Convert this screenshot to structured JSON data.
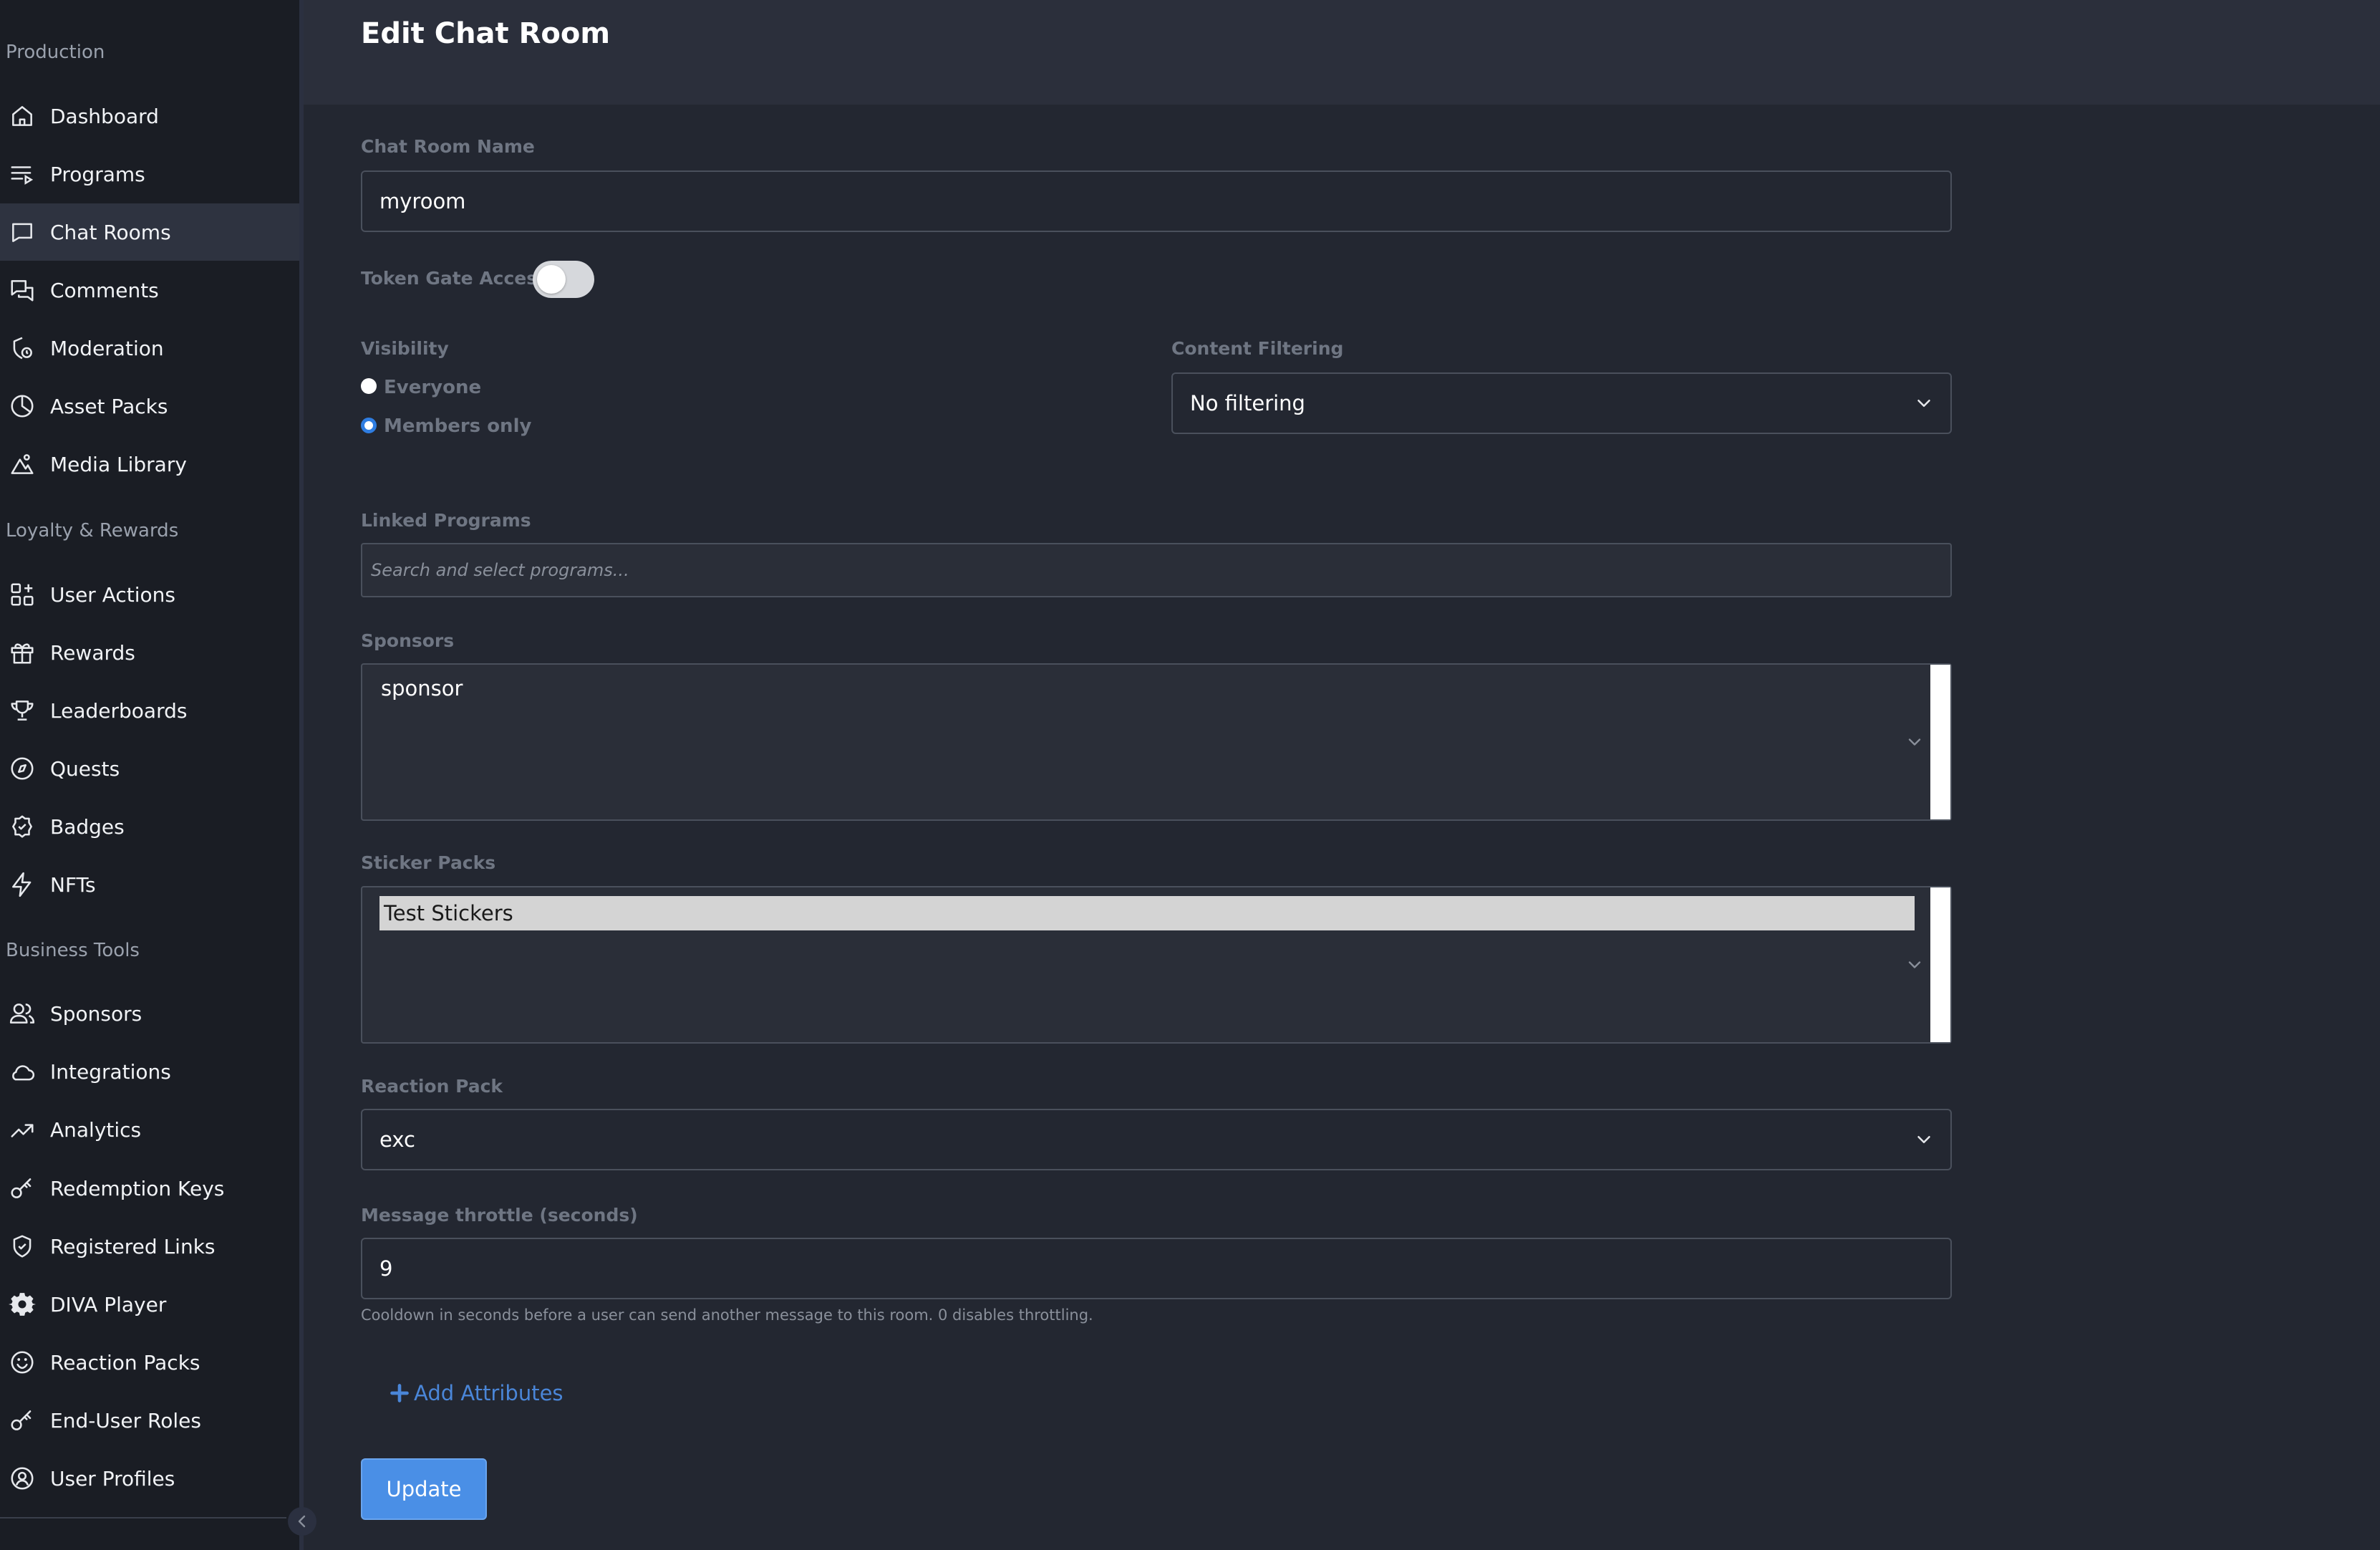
{
  "sidebar": {
    "sections": [
      {
        "title": "Production"
      },
      {
        "title": "Loyalty & Rewards"
      },
      {
        "title": "Business Tools"
      }
    ],
    "items": [
      {
        "label": "Dashboard",
        "icon": "home-icon"
      },
      {
        "label": "Programs",
        "icon": "playlist-icon"
      },
      {
        "label": "Chat Rooms",
        "icon": "chat-bubble-icon",
        "active": true
      },
      {
        "label": "Comments",
        "icon": "comments-icon"
      },
      {
        "label": "Moderation",
        "icon": "moderation-icon"
      },
      {
        "label": "Asset Packs",
        "icon": "pie-chart-icon"
      },
      {
        "label": "Media Library",
        "icon": "image-icon"
      },
      {
        "label": "User Actions",
        "icon": "grid-plus-icon"
      },
      {
        "label": "Rewards",
        "icon": "gift-icon"
      },
      {
        "label": "Leaderboards",
        "icon": "trophy-icon"
      },
      {
        "label": "Quests",
        "icon": "compass-icon"
      },
      {
        "label": "Badges",
        "icon": "badge-icon"
      },
      {
        "label": "NFTs",
        "icon": "lightning-icon"
      },
      {
        "label": "Sponsors",
        "icon": "users-icon"
      },
      {
        "label": "Integrations",
        "icon": "cloud-icon"
      },
      {
        "label": "Analytics",
        "icon": "trending-icon"
      },
      {
        "label": "Redemption Keys",
        "icon": "key-icon"
      },
      {
        "label": "Registered Links",
        "icon": "shield-check-icon"
      },
      {
        "label": "DIVA Player",
        "icon": "gear-icon"
      },
      {
        "label": "Reaction Packs",
        "icon": "smile-icon"
      },
      {
        "label": "End-User Roles",
        "icon": "key-icon"
      },
      {
        "label": "User Profiles",
        "icon": "user-circle-icon"
      }
    ]
  },
  "header": {
    "title": "Edit Chat Room"
  },
  "form": {
    "chat_room_name": {
      "label": "Chat Room Name",
      "value": "myroom"
    },
    "token_gate": {
      "label": "Token Gate Access",
      "enabled": false
    },
    "visibility": {
      "label": "Visibility",
      "options": [
        "Everyone",
        "Members only"
      ],
      "selected": "Members only"
    },
    "content_filtering": {
      "label": "Content Filtering",
      "value": "No filtering"
    },
    "linked_programs": {
      "label": "Linked Programs",
      "placeholder": "Search and select programs..."
    },
    "sponsors": {
      "label": "Sponsors",
      "options": [
        "sponsor"
      ]
    },
    "sticker_packs": {
      "label": "Sticker Packs",
      "options": [
        "Test Stickers"
      ],
      "selected": "Test Stickers"
    },
    "reaction_pack": {
      "label": "Reaction Pack",
      "value": "exc"
    },
    "message_throttle": {
      "label": "Message throttle (seconds)",
      "value": "9",
      "help": "Cooldown in seconds before a user can send another message to this room. 0 disables throttling."
    },
    "add_attributes_label": "Add Attributes",
    "update_label": "Update"
  },
  "colors": {
    "sidebar_bg": "#1a1d24",
    "page_bg": "#232731",
    "header_bg": "#2b2f3b",
    "active_item_bg": "#2e3340",
    "accent": "#4a8fe6",
    "link": "#4a86d8"
  }
}
